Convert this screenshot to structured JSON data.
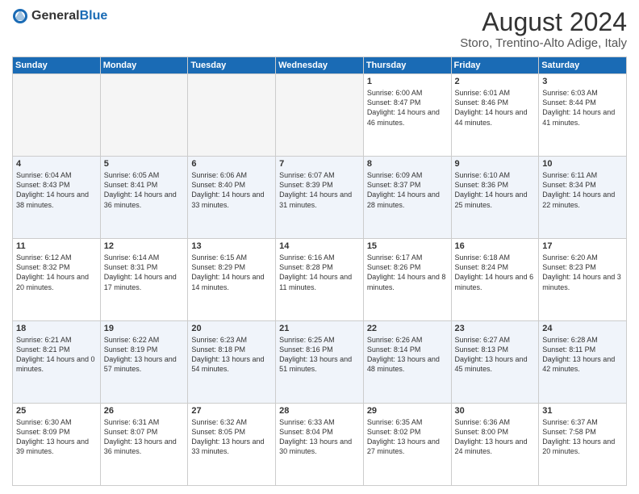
{
  "logo": {
    "general": "General",
    "blue": "Blue"
  },
  "title": "August 2024",
  "subtitle": "Storo, Trentino-Alto Adige, Italy",
  "headers": [
    "Sunday",
    "Monday",
    "Tuesday",
    "Wednesday",
    "Thursday",
    "Friday",
    "Saturday"
  ],
  "weeks": [
    [
      {
        "day": "",
        "info": ""
      },
      {
        "day": "",
        "info": ""
      },
      {
        "day": "",
        "info": ""
      },
      {
        "day": "",
        "info": ""
      },
      {
        "day": "1",
        "info": "Sunrise: 6:00 AM\nSunset: 8:47 PM\nDaylight: 14 hours and 46 minutes."
      },
      {
        "day": "2",
        "info": "Sunrise: 6:01 AM\nSunset: 8:46 PM\nDaylight: 14 hours and 44 minutes."
      },
      {
        "day": "3",
        "info": "Sunrise: 6:03 AM\nSunset: 8:44 PM\nDaylight: 14 hours and 41 minutes."
      }
    ],
    [
      {
        "day": "4",
        "info": "Sunrise: 6:04 AM\nSunset: 8:43 PM\nDaylight: 14 hours and 38 minutes."
      },
      {
        "day": "5",
        "info": "Sunrise: 6:05 AM\nSunset: 8:41 PM\nDaylight: 14 hours and 36 minutes."
      },
      {
        "day": "6",
        "info": "Sunrise: 6:06 AM\nSunset: 8:40 PM\nDaylight: 14 hours and 33 minutes."
      },
      {
        "day": "7",
        "info": "Sunrise: 6:07 AM\nSunset: 8:39 PM\nDaylight: 14 hours and 31 minutes."
      },
      {
        "day": "8",
        "info": "Sunrise: 6:09 AM\nSunset: 8:37 PM\nDaylight: 14 hours and 28 minutes."
      },
      {
        "day": "9",
        "info": "Sunrise: 6:10 AM\nSunset: 8:36 PM\nDaylight: 14 hours and 25 minutes."
      },
      {
        "day": "10",
        "info": "Sunrise: 6:11 AM\nSunset: 8:34 PM\nDaylight: 14 hours and 22 minutes."
      }
    ],
    [
      {
        "day": "11",
        "info": "Sunrise: 6:12 AM\nSunset: 8:32 PM\nDaylight: 14 hours and 20 minutes."
      },
      {
        "day": "12",
        "info": "Sunrise: 6:14 AM\nSunset: 8:31 PM\nDaylight: 14 hours and 17 minutes."
      },
      {
        "day": "13",
        "info": "Sunrise: 6:15 AM\nSunset: 8:29 PM\nDaylight: 14 hours and 14 minutes."
      },
      {
        "day": "14",
        "info": "Sunrise: 6:16 AM\nSunset: 8:28 PM\nDaylight: 14 hours and 11 minutes."
      },
      {
        "day": "15",
        "info": "Sunrise: 6:17 AM\nSunset: 8:26 PM\nDaylight: 14 hours and 8 minutes."
      },
      {
        "day": "16",
        "info": "Sunrise: 6:18 AM\nSunset: 8:24 PM\nDaylight: 14 hours and 6 minutes."
      },
      {
        "day": "17",
        "info": "Sunrise: 6:20 AM\nSunset: 8:23 PM\nDaylight: 14 hours and 3 minutes."
      }
    ],
    [
      {
        "day": "18",
        "info": "Sunrise: 6:21 AM\nSunset: 8:21 PM\nDaylight: 14 hours and 0 minutes."
      },
      {
        "day": "19",
        "info": "Sunrise: 6:22 AM\nSunset: 8:19 PM\nDaylight: 13 hours and 57 minutes."
      },
      {
        "day": "20",
        "info": "Sunrise: 6:23 AM\nSunset: 8:18 PM\nDaylight: 13 hours and 54 minutes."
      },
      {
        "day": "21",
        "info": "Sunrise: 6:25 AM\nSunset: 8:16 PM\nDaylight: 13 hours and 51 minutes."
      },
      {
        "day": "22",
        "info": "Sunrise: 6:26 AM\nSunset: 8:14 PM\nDaylight: 13 hours and 48 minutes."
      },
      {
        "day": "23",
        "info": "Sunrise: 6:27 AM\nSunset: 8:13 PM\nDaylight: 13 hours and 45 minutes."
      },
      {
        "day": "24",
        "info": "Sunrise: 6:28 AM\nSunset: 8:11 PM\nDaylight: 13 hours and 42 minutes."
      }
    ],
    [
      {
        "day": "25",
        "info": "Sunrise: 6:30 AM\nSunset: 8:09 PM\nDaylight: 13 hours and 39 minutes."
      },
      {
        "day": "26",
        "info": "Sunrise: 6:31 AM\nSunset: 8:07 PM\nDaylight: 13 hours and 36 minutes."
      },
      {
        "day": "27",
        "info": "Sunrise: 6:32 AM\nSunset: 8:05 PM\nDaylight: 13 hours and 33 minutes."
      },
      {
        "day": "28",
        "info": "Sunrise: 6:33 AM\nSunset: 8:04 PM\nDaylight: 13 hours and 30 minutes."
      },
      {
        "day": "29",
        "info": "Sunrise: 6:35 AM\nSunset: 8:02 PM\nDaylight: 13 hours and 27 minutes."
      },
      {
        "day": "30",
        "info": "Sunrise: 6:36 AM\nSunset: 8:00 PM\nDaylight: 13 hours and 24 minutes."
      },
      {
        "day": "31",
        "info": "Sunrise: 6:37 AM\nSunset: 7:58 PM\nDaylight: 13 hours and 20 minutes."
      }
    ]
  ]
}
